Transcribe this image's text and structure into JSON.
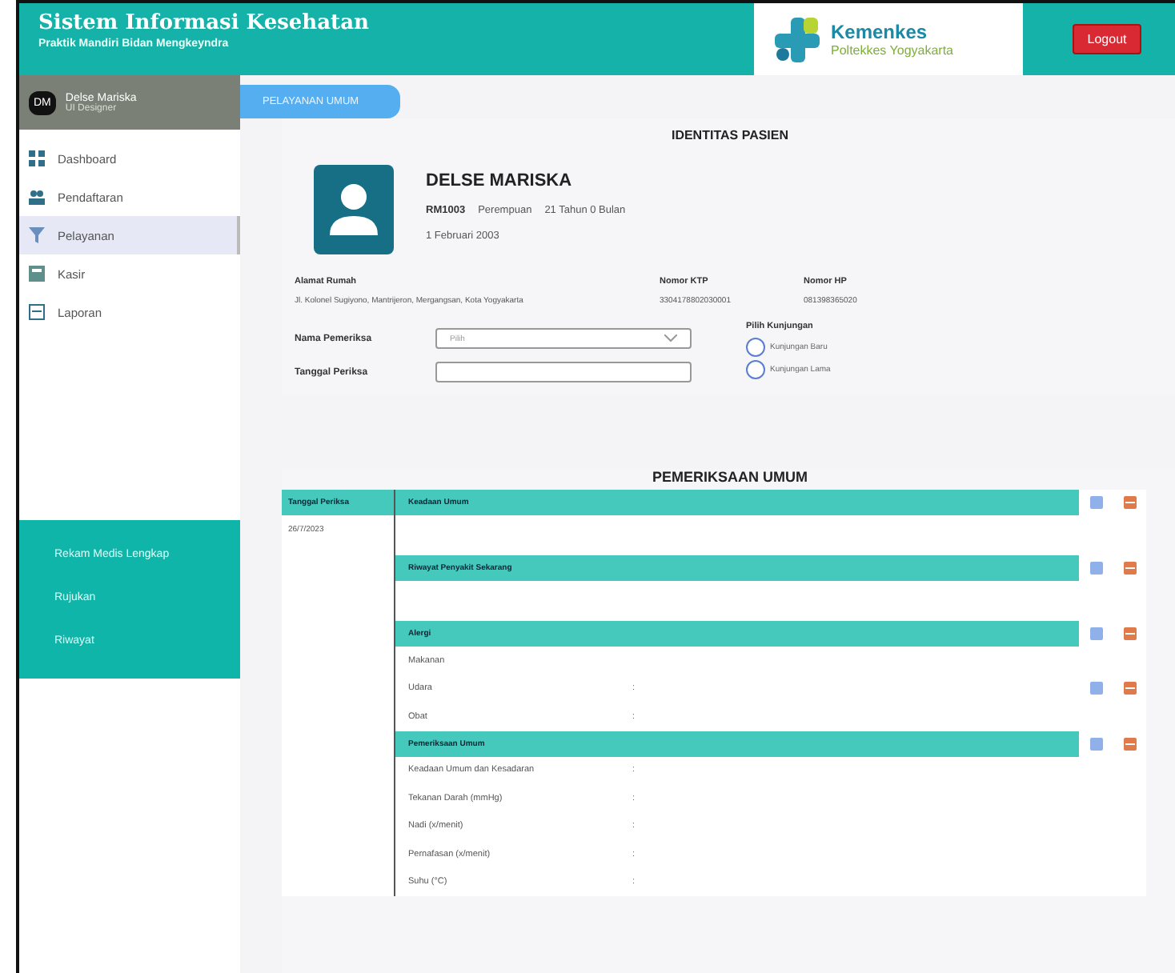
{
  "header": {
    "title": "Sistem Informasi Kesehatan",
    "subtitle": "Praktik Mandiri Bidan Mengkeyndra",
    "logo_name": "Kemenkes",
    "logo_sub": "Poltekkes Yogyakarta",
    "logout": "Logout"
  },
  "user": {
    "initials": "DM",
    "name": "Delse Mariska",
    "role": "UI Designer"
  },
  "menu": [
    {
      "label": "Dashboard",
      "selected": false
    },
    {
      "label": "Pendaftaran",
      "selected": false
    },
    {
      "label": "Pelayanan",
      "selected": true
    },
    {
      "label": "Kasir",
      "selected": false
    },
    {
      "label": "Laporan",
      "selected": false
    }
  ],
  "submenu": [
    "Rekam Medis Lengkap",
    "Rujukan",
    "Riwayat"
  ],
  "tab": "PELAYANAN UMUM",
  "identity": {
    "title": "IDENTITAS PASIEN",
    "name": "DELSE MARISKA",
    "rm": "RM1003",
    "gender": "Perempuan",
    "age": "21 Tahun  0 Bulan",
    "birth": "1 Februari 2003",
    "fields": [
      {
        "label": "Alamat Rumah",
        "value": "Jl. Kolonel Sugiyono, Mantrijeron, Mergangsan, Kota Yogyakarta"
      },
      {
        "label": "Nomor KTP",
        "value": "3304178802030001"
      },
      {
        "label": "Nomor HP",
        "value": "081398365020"
      }
    ],
    "examiner_label": "Nama Pemeriksa",
    "examiner_placeholder": "Pilih",
    "date_label": "Tanggal Periksa",
    "visit_label": "Pilih Kunjungan",
    "visits": [
      {
        "label": "Kunjungan Baru",
        "selected": false
      },
      {
        "label": "Kunjungan Lama",
        "selected": false
      }
    ]
  },
  "exam": {
    "title": "PEMERIKSAAN UMUM",
    "date_header": "Tanggal Periksa",
    "date": "26/7/2023",
    "sections": [
      {
        "title": "Keadaan Umum"
      },
      {
        "title": "Riwayat Penyakit Sekarang"
      },
      {
        "title": "Alergi",
        "rows": [
          {
            "label": "Makanan",
            "sep": "",
            "actions": false
          },
          {
            "label": "Udara",
            "sep": ":",
            "actions": true
          },
          {
            "label": "Obat",
            "sep": ":",
            "actions": false
          }
        ]
      },
      {
        "title": "Pemeriksaan Umum",
        "rows": [
          {
            "label": "Keadaan Umum dan Kesadaran",
            "sep": ":",
            "actions": false
          },
          {
            "label": "Tekanan Darah (mmHg)",
            "sep": ":",
            "actions": false
          },
          {
            "label": "Nadi (x/menit)",
            "sep": ":",
            "actions": false
          },
          {
            "label": "Pernafasan (x/menit)",
            "sep": ":",
            "actions": false
          },
          {
            "label": "Suhu (°C)",
            "sep": ":",
            "actions": false
          }
        ]
      }
    ]
  }
}
